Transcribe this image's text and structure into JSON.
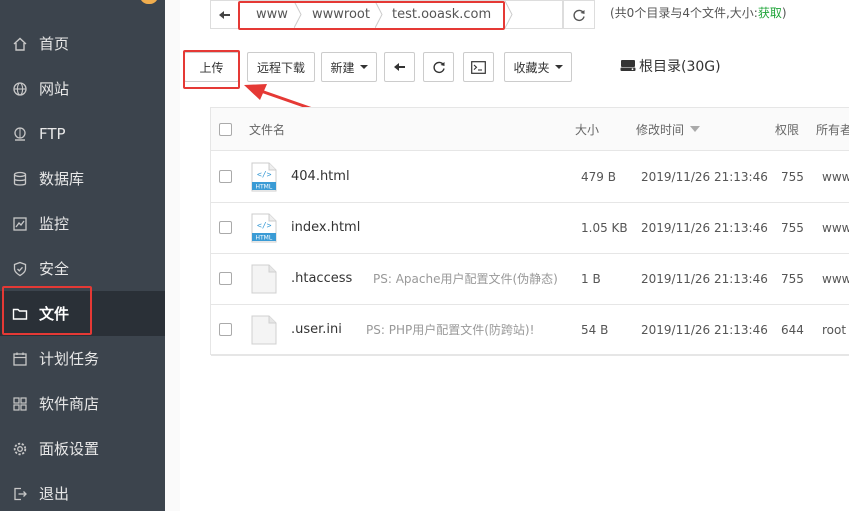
{
  "sidebar": {
    "items": [
      {
        "label": "首页",
        "icon": "home-icon"
      },
      {
        "label": "网站",
        "icon": "globe-icon"
      },
      {
        "label": "FTP",
        "icon": "ftp-icon"
      },
      {
        "label": "数据库",
        "icon": "database-icon"
      },
      {
        "label": "监控",
        "icon": "monitor-icon"
      },
      {
        "label": "安全",
        "icon": "shield-icon"
      },
      {
        "label": "文件",
        "icon": "folder-icon",
        "active": true
      },
      {
        "label": "计划任务",
        "icon": "calendar-icon"
      },
      {
        "label": "软件商店",
        "icon": "apps-icon"
      },
      {
        "label": "面板设置",
        "icon": "gear-icon"
      },
      {
        "label": "退出",
        "icon": "logout-icon"
      }
    ]
  },
  "address": {
    "crumbs": [
      "www",
      "wwwroot",
      "test.ooask.com"
    ],
    "info_prefix": "(共0个目录与4个文件,大小:",
    "info_link": "获取",
    "info_suffix": ")"
  },
  "toolbar": {
    "upload": "上传",
    "remote_download": "远程下载",
    "new": "新建",
    "favorites": "收藏夹",
    "disk": "根目录(30G)"
  },
  "table": {
    "headers": {
      "name": "文件名",
      "size": "大小",
      "mtime": "修改时间",
      "perm": "权限",
      "owner": "所有者"
    },
    "rows": [
      {
        "name": "404.html",
        "ps": "",
        "size": "479 B",
        "mtime": "2019/11/26 21:13:46",
        "perm": "755",
        "owner": "www",
        "icon": "html-file-icon"
      },
      {
        "name": "index.html",
        "ps": "",
        "size": "1.05 KB",
        "mtime": "2019/11/26 21:13:46",
        "perm": "755",
        "owner": "www",
        "icon": "html-file-icon"
      },
      {
        "name": ".htaccess",
        "ps": "PS: Apache用户配置文件(伪静态)",
        "size": "1 B",
        "mtime": "2019/11/26 21:13:46",
        "perm": "755",
        "owner": "www",
        "icon": "blank-file-icon"
      },
      {
        "name": ".user.ini",
        "ps": "PS: PHP用户配置文件(防跨站)!",
        "size": "54 B",
        "mtime": "2019/11/26 21:13:46",
        "perm": "644",
        "owner": "root",
        "icon": "blank-file-icon"
      }
    ]
  },
  "colors": {
    "sidebar_bg": "#3c444d",
    "sidebar_active_bg": "#2a3037",
    "highlight_red": "#e53935",
    "link_green": "#20a53a",
    "badge_orange": "#f0ad4e"
  }
}
